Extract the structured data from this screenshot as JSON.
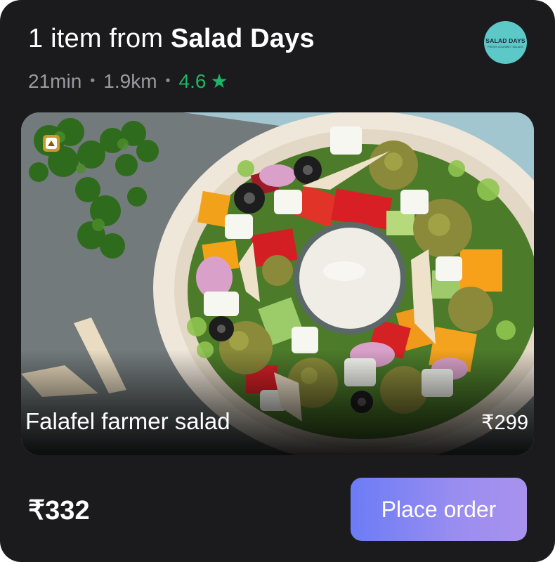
{
  "header": {
    "title_prefix": "1 item from",
    "restaurant_name": "Salad Days",
    "eta": "21min",
    "distance": "1.9km",
    "rating": "4.6",
    "separator": "•",
    "star": "★",
    "logo": {
      "text": "SALAD DAYS",
      "tagline": "FRESH GOURMET SALADS"
    }
  },
  "item": {
    "name": "Falafel farmer salad",
    "price": "₹299",
    "veg_badge_icon": "triangle-veg-icon"
  },
  "footer": {
    "total": "₹332",
    "cta_label": "Place order"
  },
  "colors": {
    "card_bg": "#1b1b1d",
    "rating_green": "#1fb566",
    "cta_gradient_start": "#6b7cf6",
    "cta_gradient_end": "#a892ee",
    "logo_bg": "#5cc8c8"
  }
}
